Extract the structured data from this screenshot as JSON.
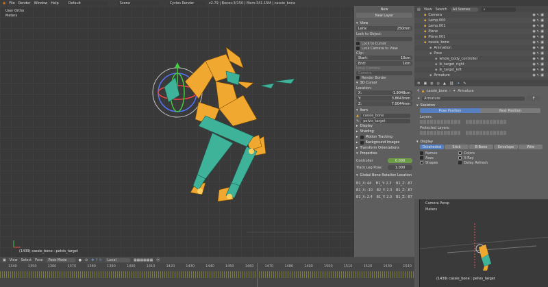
{
  "topbar": {
    "menus": [
      "File",
      "Render",
      "Window",
      "Help"
    ],
    "layout": "Default",
    "scene": "Scene",
    "engine": "Cycles Render",
    "stats": "v2.79 | Bones:3/150 | Mem:341.15M | cassie_bone"
  },
  "viewport": {
    "view_name": "User Ortho",
    "units": "Meters",
    "status": "(1439) cassie_bone : pelvis_target"
  },
  "vp_header": {
    "menus": [
      "View",
      "Select",
      "Pose"
    ],
    "mode": "Pose Mode",
    "orientation": "Local"
  },
  "timeline": {
    "ticks": [
      "1340",
      "1350",
      "1360",
      "1370",
      "1380",
      "1390",
      "1400",
      "1410",
      "1420",
      "1430",
      "1440",
      "1450",
      "1460",
      "1470",
      "1480",
      "1490",
      "1500",
      "1510",
      "1520",
      "1530",
      "1540"
    ]
  },
  "npanel": {
    "tab_new": "New",
    "new_layer": "New Layer",
    "view_title": "View",
    "lens_label": "Lens:",
    "lens_value": "250mm",
    "lock_obj": "Lock to Object:",
    "lock_cursor": "Lock to Cursor",
    "lock_cam": "Lock Camera to View",
    "clip_title": "Clip:",
    "start_label": "Start:",
    "start_value": "10cm",
    "end_label": "End:",
    "end_value": "1km",
    "local_cam": "Local Camera:",
    "camera": "Camera",
    "render_border": "Render Border",
    "cursor_title": "3D Cursor",
    "location": "Location:",
    "x_label": "X:",
    "x_value": "-1.9048cm",
    "y_label": "Y:",
    "y_value": "3.8643mm",
    "z_label": "Z:",
    "z_value": "7.0044mm",
    "item_title": "Item",
    "item_name": "cassie_bone",
    "bone_name": "pelvis_target",
    "display": "Display",
    "shading": "Shading",
    "motion": "Motion Tracking",
    "background": "Background Images",
    "transform": "Transform Orientations",
    "props": "Properties",
    "ctrl_label": "Controller",
    "ctrl_value": "0.000",
    "leg_label": "Track Leg Pose",
    "leg_value": "1.000",
    "gbrl": "Global Bone Rotation Location",
    "rot_rows": [
      [
        "B1_X: 44",
        "B1_Y: 2.3",
        "B1_Z: -87"
      ],
      [
        "B1_X: -10",
        "B2_Y: 2.3",
        "B1_Z: -87"
      ],
      [
        "B1_X: 2.4",
        "B1_Y: 2.3",
        "B1_Z: -87"
      ]
    ]
  },
  "outliner": {
    "view": "View",
    "search": "Search",
    "scenes": "All Scenes",
    "items": [
      {
        "label": "Camera",
        "lvl": 0
      },
      {
        "label": "Lamp.000",
        "lvl": 0
      },
      {
        "label": "Lamp.001",
        "lvl": 0
      },
      {
        "label": "Plane",
        "lvl": 0
      },
      {
        "label": "Plane.001",
        "lvl": 0
      },
      {
        "label": "cassie_bone",
        "lvl": 0
      },
      {
        "label": "Animation",
        "lvl": 1
      },
      {
        "label": "Pose",
        "lvl": 1
      },
      {
        "label": "whole_body_controller",
        "lvl": 2
      },
      {
        "label": "ik_target_right",
        "lvl": 2
      },
      {
        "label": "ik_target_left",
        "lvl": 2
      },
      {
        "label": "Armature",
        "lvl": 1
      }
    ]
  },
  "props": {
    "breadcrumb_obj": "cassie_bone",
    "breadcrumb_data": "Armature",
    "name": "Armature",
    "f": "F",
    "skeleton": "Skeleton",
    "pose_pos": "Pose Position",
    "rest_pos": "Rest Position",
    "layers": "Layers:",
    "prot_layers": "Protected Layers:",
    "display": "Display",
    "disp_opts": [
      "Octahedral",
      "Stick",
      "B-Bone",
      "Envelope",
      "Wire"
    ],
    "names": "Names",
    "axes": "Axes",
    "shapes": "Shapes",
    "colors": "Colors",
    "xray": "X-Ray",
    "delay": "Delay Refresh"
  },
  "camview": {
    "title": "Camera Persp",
    "units": "Meters",
    "status": "(1439) cassie_bone : pelvis_target"
  },
  "colors": {
    "accent": "#5680c2",
    "bone_orange": "#f0a830",
    "bone_teal": "#3fb39a"
  }
}
